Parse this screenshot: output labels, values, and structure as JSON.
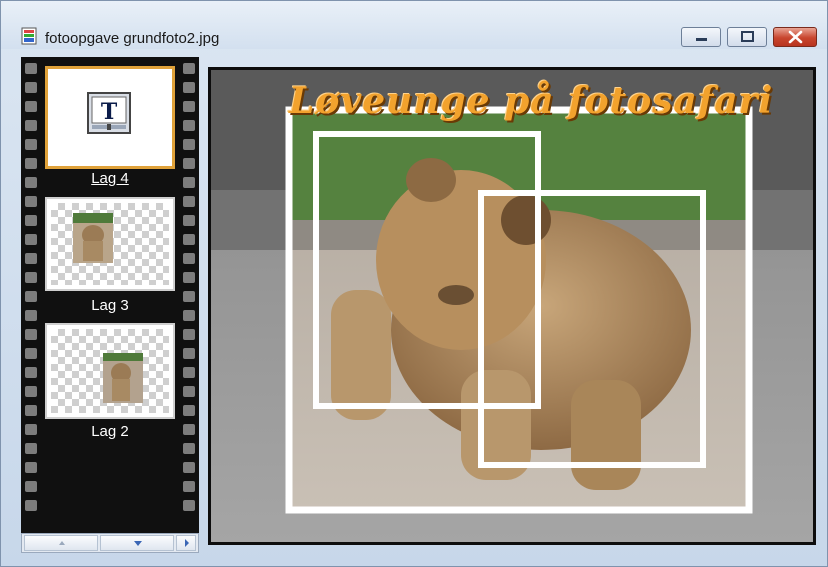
{
  "window": {
    "title": "fotoopgave grundfoto2.jpg",
    "icon": "image-document-icon",
    "controls": [
      "minimize-icon",
      "maximize-icon",
      "close-icon"
    ]
  },
  "layers": [
    {
      "label": "Lag 4",
      "kind": "text-layer",
      "icon": "text-layer-icon",
      "selected": true
    },
    {
      "label": "Lag 3",
      "kind": "image-layer",
      "selected": false
    },
    {
      "label": "Lag 2",
      "kind": "image-layer",
      "selected": false
    }
  ],
  "scroll_controls": [
    "scroll-up-icon",
    "scroll-down-icon",
    "scroll-right-icon"
  ],
  "document": {
    "title_text": "Løveunge på fotosafari"
  },
  "colors": {
    "title_text": "#f2a22d",
    "selected_layer_border": "#e0a23a",
    "filmstrip": "#101010",
    "close_button": "#c8452e"
  }
}
